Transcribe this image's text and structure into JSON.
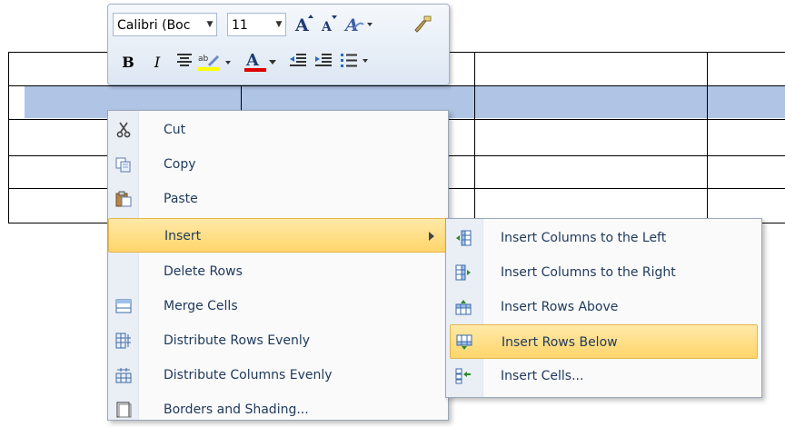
{
  "mini_toolbar": {
    "font_name": "Calibri (Boc",
    "font_size": "11",
    "bold_glyph": "B",
    "italic_glyph": "I",
    "font_color_glyph": "A"
  },
  "context_menu": {
    "items": [
      {
        "label": "Cut",
        "icon": "scissors-icon"
      },
      {
        "label": "Copy",
        "icon": "copy-icon"
      },
      {
        "label": "Paste",
        "icon": "clipboard-icon"
      },
      {
        "label": "Insert",
        "icon": "",
        "highlighted": true,
        "has_submenu": true
      },
      {
        "label": "Delete Rows",
        "icon": ""
      },
      {
        "label": "Merge Cells",
        "icon": "merge-cells-icon"
      },
      {
        "label": "Distribute Rows Evenly",
        "icon": "distribute-rows-icon"
      },
      {
        "label": "Distribute Columns Evenly",
        "icon": "distribute-columns-icon"
      },
      {
        "label": "Borders and Shading...",
        "icon": "borders-shading-icon"
      }
    ]
  },
  "insert_submenu": {
    "items": [
      {
        "label": "Insert Columns to the Left",
        "icon": "insert-column-left-icon"
      },
      {
        "label": "Insert Columns to the Right",
        "icon": "insert-column-right-icon"
      },
      {
        "label": "Insert Rows Above",
        "icon": "insert-row-above-icon"
      },
      {
        "label": "Insert Rows Below",
        "icon": "insert-row-below-icon",
        "highlighted": true
      },
      {
        "label": "Insert Cells...",
        "icon": "insert-cells-icon"
      }
    ]
  },
  "colors": {
    "selection": "#b0c4e6",
    "highlight": "#ffd56b",
    "menu_text": "#1e395b"
  }
}
